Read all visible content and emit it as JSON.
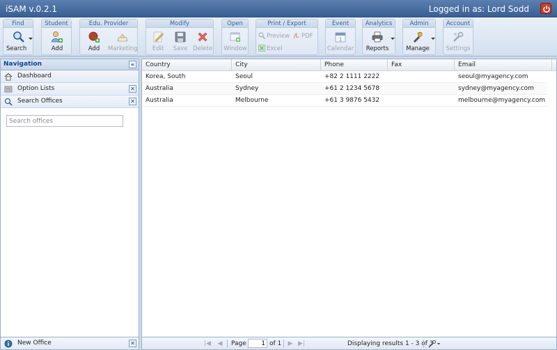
{
  "app": {
    "title": "iSAM v.0.2.1",
    "login": "Logged in as: Lord Sodd"
  },
  "toolbar": {
    "find": {
      "title": "Find",
      "search": "Search"
    },
    "student": {
      "title": "Student",
      "add": "Add"
    },
    "provider": {
      "title": "Edu. Provider",
      "add": "Add",
      "marketing": "Marketing"
    },
    "modify": {
      "title": "Modify",
      "edit": "Edit",
      "save": "Save",
      "delete": "Delete"
    },
    "open": {
      "title": "Open",
      "window": "Window"
    },
    "print": {
      "title": "Print / Export",
      "preview": "Preview",
      "pdf": "PDF",
      "excel": "Excel"
    },
    "event": {
      "title": "Event",
      "calendar": "Calendar"
    },
    "analytics": {
      "title": "Analytics",
      "reports": "Reports"
    },
    "admin": {
      "title": "Admin",
      "manage": "Manage"
    },
    "account": {
      "title": "Account",
      "settings": "Settings"
    }
  },
  "nav": {
    "title": "Navigation",
    "items": [
      {
        "label": "Dashboard",
        "icon": "home-icon"
      },
      {
        "label": "Option Lists",
        "icon": "list-icon"
      },
      {
        "label": "Search Offices",
        "icon": "search-icon"
      }
    ],
    "search_placeholder": "Search offices",
    "footer": "New Office"
  },
  "grid": {
    "columns": [
      "Country",
      "City",
      "Phone",
      "Fax",
      "Email"
    ],
    "rows": [
      {
        "country": "Korea, South",
        "city": "Seoul",
        "phone": "+82 2 1111 2222",
        "fax": "",
        "email": "seoul@myagency.com"
      },
      {
        "country": "Australia",
        "city": "Sydney",
        "phone": "+61 2 1234 5678",
        "fax": "",
        "email": "sydney@myagency.com"
      },
      {
        "country": "Australia",
        "city": "Melbourne",
        "phone": "+61 3 9876 5432",
        "fax": "",
        "email": "melbourne@myagency.com"
      }
    ]
  },
  "pager": {
    "page_label": "Page",
    "page_value": "1",
    "of_label": "of 1",
    "status": "Displaying results 1 - 3 of 3"
  }
}
